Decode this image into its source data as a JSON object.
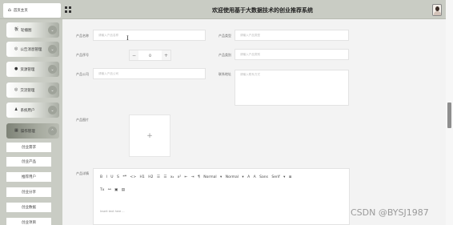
{
  "topbar": {
    "home_label": "首页主页",
    "title": "欢迎使用基于大数据技术的创业推荐系统"
  },
  "sidebar": {
    "menus": [
      {
        "icon": "板",
        "label": "轮播图"
      },
      {
        "icon": "◎",
        "label": "公告消息管理"
      },
      {
        "icon": "●",
        "label": "资源管理"
      },
      {
        "icon": "◎",
        "label": "交流管理"
      },
      {
        "icon": "♟",
        "label": "系统用户"
      },
      {
        "icon": "▦",
        "label": "操作管理"
      }
    ],
    "submenu": [
      "创业需求",
      "创业产品",
      "推荐用户",
      "创业分享",
      "创业数据",
      "创业项目"
    ]
  },
  "form": {
    "product_name": {
      "label": "产品名称",
      "placeholder": "请输入产品名称"
    },
    "product_type": {
      "label": "产品类型",
      "placeholder": "请输入产品类型"
    },
    "sort": {
      "label": "产品序号",
      "value": "0",
      "minus": "−",
      "plus": "+"
    },
    "company": {
      "label": "产品公司",
      "placeholder": "请输入产品公司"
    },
    "category": {
      "label": "产品类别",
      "placeholder": "请输入产品类别"
    },
    "address": {
      "label": "联系地址",
      "placeholder": "请输入联系方式"
    },
    "image": {
      "label": "产品图片",
      "plus": "+"
    },
    "detail": {
      "label": "产品详情"
    }
  },
  "editor": {
    "toolbar_row1": "B  I  U  S   ❝❞  <>   H1  H2   ☰  ☰   x₂  x²   ⇤  ⇥   ¶   Normal  ▾   Normal  ▾   A  A   Sans Serif  ▾   ≣",
    "toolbar_row2": "Tx   ⚯   ▣   ▤",
    "placeholder": "Insert text here ..."
  },
  "watermark": "CSDN @BYSJ1987"
}
